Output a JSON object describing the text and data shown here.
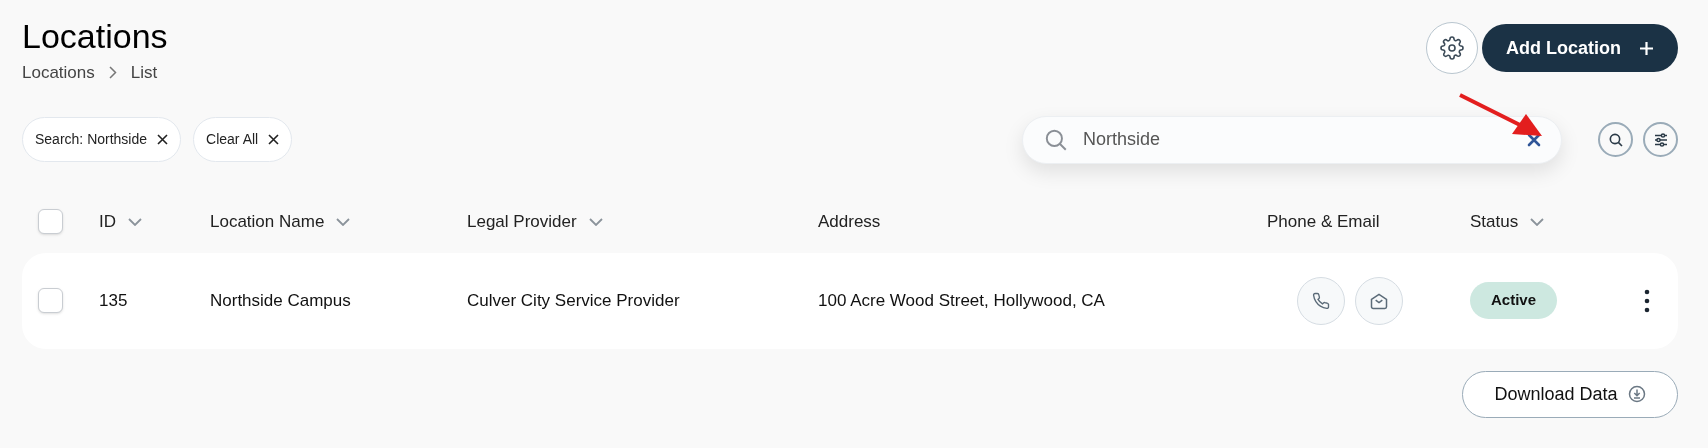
{
  "header": {
    "title": "Locations",
    "breadcrumb": [
      "Locations",
      "List"
    ]
  },
  "actions": {
    "add_button": "Add Location"
  },
  "filter_chips": [
    {
      "label": "Search: Northside"
    },
    {
      "label": "Clear All"
    }
  ],
  "search": {
    "value": "Northside"
  },
  "table": {
    "select_all": {
      "checked": false
    },
    "columns": [
      {
        "label": "ID",
        "sortable": true
      },
      {
        "label": "Location Name",
        "sortable": true
      },
      {
        "label": "Legal Provider",
        "sortable": true
      },
      {
        "label": "Address",
        "sortable": false
      },
      {
        "label": "Phone & Email",
        "sortable": false
      },
      {
        "label": "Status",
        "sortable": true
      }
    ],
    "rows": [
      {
        "selected": false,
        "id": "135",
        "name": "Northside Campus",
        "provider": "Culver City Service Provider",
        "address": "100 Acre Wood Street, Hollywood, CA",
        "status": "Active"
      }
    ]
  },
  "download_button": "Download Data"
}
